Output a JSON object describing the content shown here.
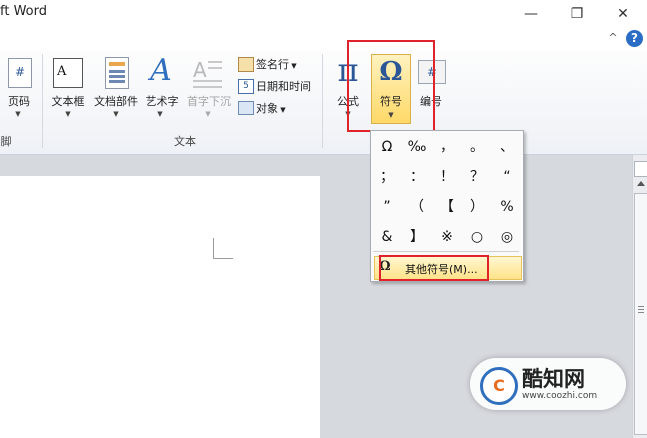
{
  "window": {
    "title": "ft Word",
    "minimize": "—",
    "restore": "❐",
    "close": "✕",
    "help_collapse": "^",
    "help": "?"
  },
  "ribbon": {
    "partial_left": {
      "label": "页码",
      "group_label": "脚"
    },
    "insert_text_group": {
      "label": "文本",
      "buttons": [
        {
          "label": "文本框",
          "icon": "textbox-icon"
        },
        {
          "label": "文档部件",
          "icon": "quickparts-icon"
        },
        {
          "label": "艺术字",
          "icon": "wordart-icon"
        },
        {
          "label": "首字下沉",
          "icon": "dropcap-icon",
          "disabled": true
        }
      ],
      "small": [
        {
          "label": "签名行",
          "icon": "signature-icon"
        },
        {
          "label": "日期和时间",
          "icon": "date-time-icon"
        },
        {
          "label": "对象",
          "icon": "object-icon"
        }
      ]
    },
    "symbols_group": {
      "equation": {
        "label": "公式",
        "glyph": "π"
      },
      "symbol": {
        "label": "符号",
        "glyph": "Ω"
      },
      "number": {
        "label": "编号",
        "glyph": "#"
      }
    }
  },
  "symbol_dropdown": {
    "symbols": [
      "Ω",
      "‰",
      "，",
      "。",
      "、",
      "；",
      "：",
      "！",
      "？",
      "“",
      "”",
      "（",
      "【",
      "）",
      "%",
      "&",
      "】",
      "※",
      "○",
      "◎"
    ],
    "more_symbols": {
      "icon": "Ω",
      "label": "其他符号(M)..."
    }
  },
  "watermark": {
    "name": "酷知网",
    "url": "www.coozhi.com",
    "logo_text": "C"
  },
  "colors": {
    "highlight": "#e0222a",
    "hover_gold": "#ffe38a",
    "accent_blue": "#2b5797"
  }
}
